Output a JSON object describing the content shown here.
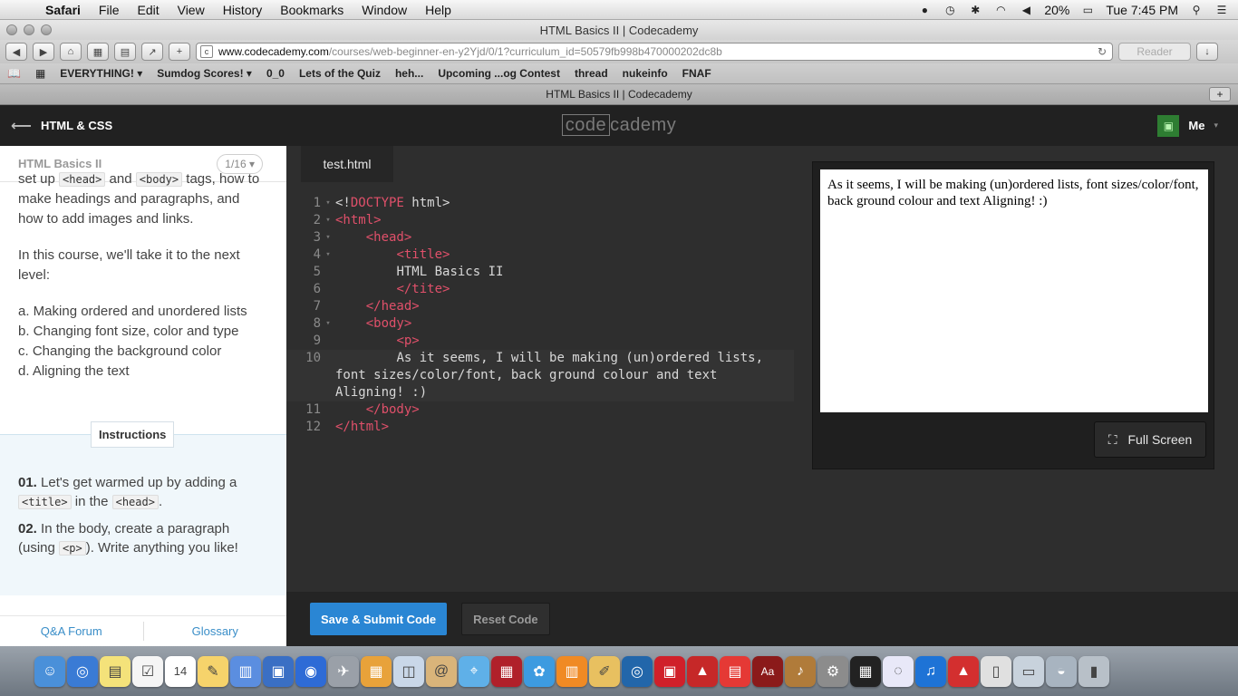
{
  "menubar": {
    "app": "Safari",
    "items": [
      "File",
      "Edit",
      "View",
      "History",
      "Bookmarks",
      "Window",
      "Help"
    ],
    "battery": "20%",
    "clock": "Tue 7:45 PM"
  },
  "window": {
    "title": "HTML Basics II | Codecademy"
  },
  "toolbar": {
    "url_host": "www.codecademy.com",
    "url_path": "/courses/web-beginner-en-y2Yjd/0/1?curriculum_id=50579fb998b470000202dc8b",
    "reader": "Reader"
  },
  "bookmarks": [
    "EVERYTHING! ▾",
    "Sumdog Scores! ▾",
    "0_0",
    "Lets of the Quiz",
    "heh...",
    "Upcoming ...og Contest",
    "thread",
    "nukeinfo",
    "FNAF"
  ],
  "tab": {
    "title": "HTML Basics II | Codecademy",
    "new_tab": "+"
  },
  "cc_header": {
    "back_label": "HTML & CSS",
    "logo_a": "code",
    "logo_b": "cademy",
    "user": "Me"
  },
  "lesson": {
    "title": "HTML Basics II",
    "pager": "1/16 ▾",
    "intro_pre": "set up ",
    "intro_code1": "<head>",
    "intro_and": " and ",
    "intro_code2": "<body>",
    "intro_post": " tags, how to make headings and paragraphs, and how to add images and links.",
    "para2": "In this course, we'll take it to the next level:",
    "list": [
      "a. Making ordered and unordered lists",
      "b. Changing font size, color and type",
      "c. Changing the background color",
      "d. Aligning the text"
    ]
  },
  "instructions": {
    "tab_label": "Instructions",
    "step1_num": "01.",
    "step1_pre": "Let's get warmed up by adding a",
    "step1_code1": "<title>",
    "step1_mid": " in the ",
    "step1_code2": "<head>",
    "step1_post": ".",
    "step2_num": "02.",
    "step2_pre": "In the body, create a paragraph (using ",
    "step2_code": "<p>",
    "step2_post": "). Write anything you like!"
  },
  "left_footer": {
    "qa": "Q&A Forum",
    "glossary": "Glossary"
  },
  "editor": {
    "file_tab": "test.html",
    "lines": [
      {
        "n": "1",
        "fold": true,
        "parts": [
          [
            "tx",
            "<!"
          ],
          [
            "tag",
            "DOCTYPE"
          ],
          [
            "tx",
            " html>"
          ]
        ]
      },
      {
        "n": "2",
        "fold": true,
        "parts": [
          [
            "tag",
            "<html>"
          ]
        ]
      },
      {
        "n": "3",
        "fold": true,
        "parts": [
          [
            "tx",
            "    "
          ],
          [
            "tag",
            "<head>"
          ]
        ]
      },
      {
        "n": "4",
        "fold": true,
        "parts": [
          [
            "tx",
            "        "
          ],
          [
            "tag",
            "<title>"
          ]
        ]
      },
      {
        "n": "5",
        "fold": false,
        "parts": [
          [
            "tx",
            "        HTML Basics II"
          ]
        ]
      },
      {
        "n": "6",
        "fold": false,
        "parts": [
          [
            "tx",
            "        "
          ],
          [
            "tag",
            "</tite>"
          ]
        ]
      },
      {
        "n": "7",
        "fold": false,
        "parts": [
          [
            "tx",
            "    "
          ],
          [
            "tag",
            "</head>"
          ]
        ]
      },
      {
        "n": "8",
        "fold": true,
        "parts": [
          [
            "tx",
            "    "
          ],
          [
            "tag",
            "<body>"
          ]
        ]
      },
      {
        "n": "9",
        "fold": false,
        "parts": [
          [
            "tx",
            "        "
          ],
          [
            "tag",
            "<p>"
          ]
        ]
      },
      {
        "n": "10",
        "fold": false,
        "active": true,
        "parts": [
          [
            "tx",
            "        As it seems, I will be making (un)ordered lists, font sizes/color/font, back ground colour and text Aligning! :)"
          ]
        ]
      },
      {
        "n": "11",
        "fold": false,
        "parts": [
          [
            "tx",
            "    "
          ],
          [
            "tag",
            "</body>"
          ]
        ]
      },
      {
        "n": "12",
        "fold": false,
        "parts": [
          [
            "tag",
            "</html>"
          ]
        ]
      }
    ],
    "preview_text": "As it seems, I will be making (un)ordered lists, font sizes/color/font, back ground colour and text Aligning! :)",
    "fullscreen": "Full Screen",
    "save": "Save & Submit Code",
    "reset": "Reset Code"
  },
  "colors": {
    "accent": "#2a86d4",
    "tag": "#e0506a",
    "editor_bg": "#2e2e2e"
  },
  "dock_icons": [
    "finder-icon",
    "safari-icon",
    "notes-icon",
    "reminders-icon",
    "calendar-icon",
    "textedit-icon",
    "chart-icon",
    "keynote-icon",
    "chrome-icon",
    "launchpad-icon",
    "pages-icon",
    "preview-icon",
    "contacts-icon",
    "maps-icon",
    "photobooth-icon",
    "iphoto-icon",
    "ibooks-icon",
    "pencil-icon",
    "quicktime-icon",
    "acrobat-icon",
    "sketchup-icon",
    "layout-icon",
    "dictionary-icon",
    "garageband-icon",
    "systemprefs-icon",
    "qr-icon",
    "polymer-icon",
    "itunes-icon",
    "adobe-icon",
    "document-icon",
    "scanner-icon",
    "downloads-icon",
    "trash-icon"
  ]
}
